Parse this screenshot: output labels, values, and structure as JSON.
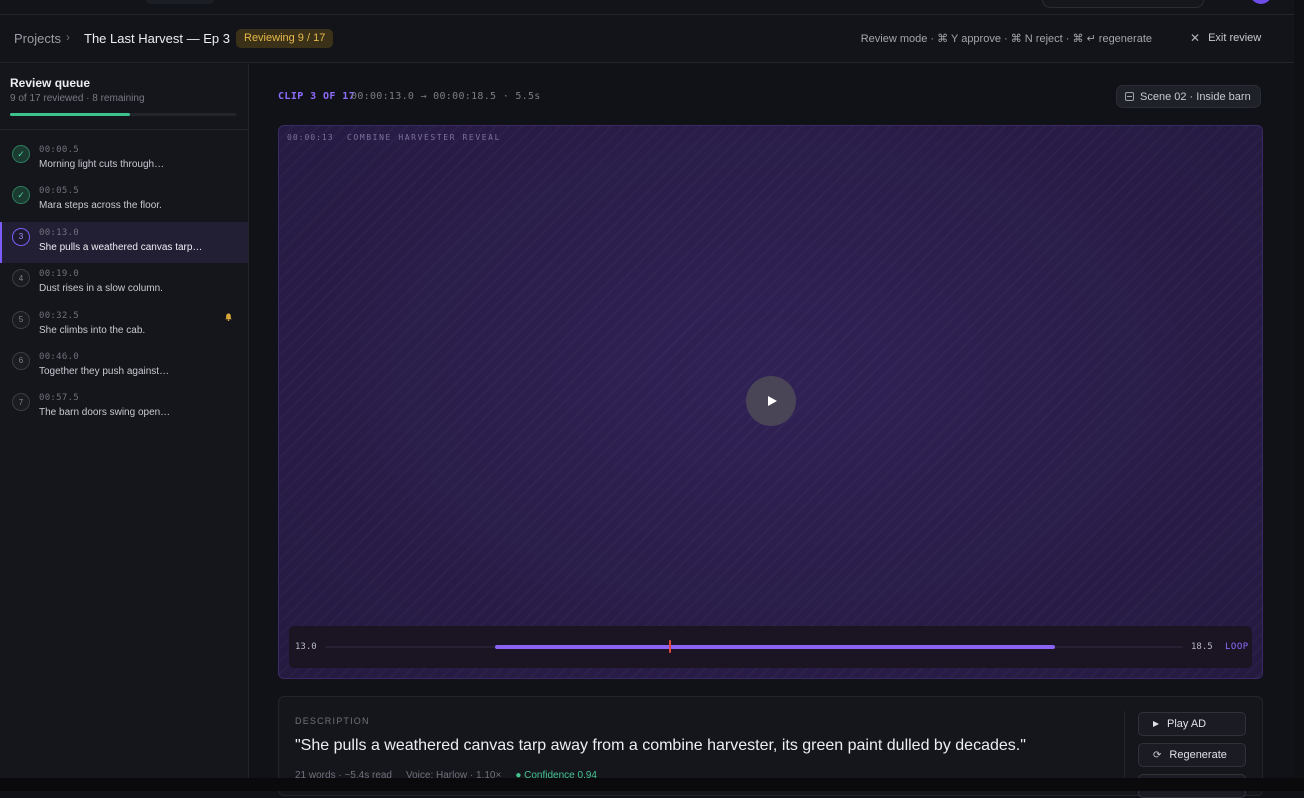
{
  "header": {
    "breadcrumb_root": "Projects",
    "breadcrumb_separator": "›",
    "project_title": "The Last Harvest — Ep 3",
    "review_badge": "Reviewing 9 / 17",
    "shortcuts": "Review mode · ⌘ Y approve · ⌘ N reject · ⌘ ↵ regenerate",
    "exit_label": "Exit review",
    "exit_icon": "close-icon"
  },
  "sidebar": {
    "title": "Review queue",
    "subtitle": "9 of 17 reviewed · 8 remaining",
    "progress_fraction": 0.53,
    "items": [
      {
        "status": "approved",
        "marker": "✓",
        "time": "00:00.5",
        "text": "Morning light cuts through…"
      },
      {
        "status": "approved",
        "marker": "✓",
        "time": "00:05.5",
        "text": "Mara steps across the floor."
      },
      {
        "status": "current",
        "marker": "3",
        "time": "00:13.0",
        "text": "She pulls a weathered canvas tarp…"
      },
      {
        "status": "pending",
        "marker": "4",
        "time": "00:19.0",
        "text": "Dust rises in a slow column."
      },
      {
        "status": "pending",
        "marker": "5",
        "time": "00:32.5",
        "text": "She climbs into the cab.",
        "flag": "bell-icon"
      },
      {
        "status": "pending",
        "marker": "6",
        "time": "00:46.0",
        "text": "Together they push against…"
      },
      {
        "status": "pending",
        "marker": "7",
        "time": "00:57.5",
        "text": "The barn doors swing open…"
      }
    ]
  },
  "clip": {
    "label": "CLIP 3 OF 17",
    "times": "00:00:13.0 → 00:00:18.5 · 5.5s",
    "scene": "Scene 02 · Inside barn"
  },
  "player": {
    "overlay_timecode": "00:00:13",
    "overlay_scene": "COMBINE HARVESTER REVEAL",
    "start_label": "13.0",
    "end_label": "18.5",
    "loop_label": "LOOP",
    "playhead_fraction": 0.31
  },
  "description": {
    "label": "DESCRIPTION",
    "text": "\"She pulls a weathered canvas tarp away from a combine harvester, its green paint dulled by decades.\"",
    "words": "21 words · ~5.4s read",
    "voice": "Voice: Harlow · 1.10×",
    "confidence": "● Confidence 0.94",
    "play_label": "Play AD",
    "regenerate_label": "Regenerate"
  },
  "colors": {
    "accent": "#8e6cff",
    "approved": "#4fd39b",
    "badge_text": "#e8b94a",
    "playhead": "#e0473d"
  }
}
